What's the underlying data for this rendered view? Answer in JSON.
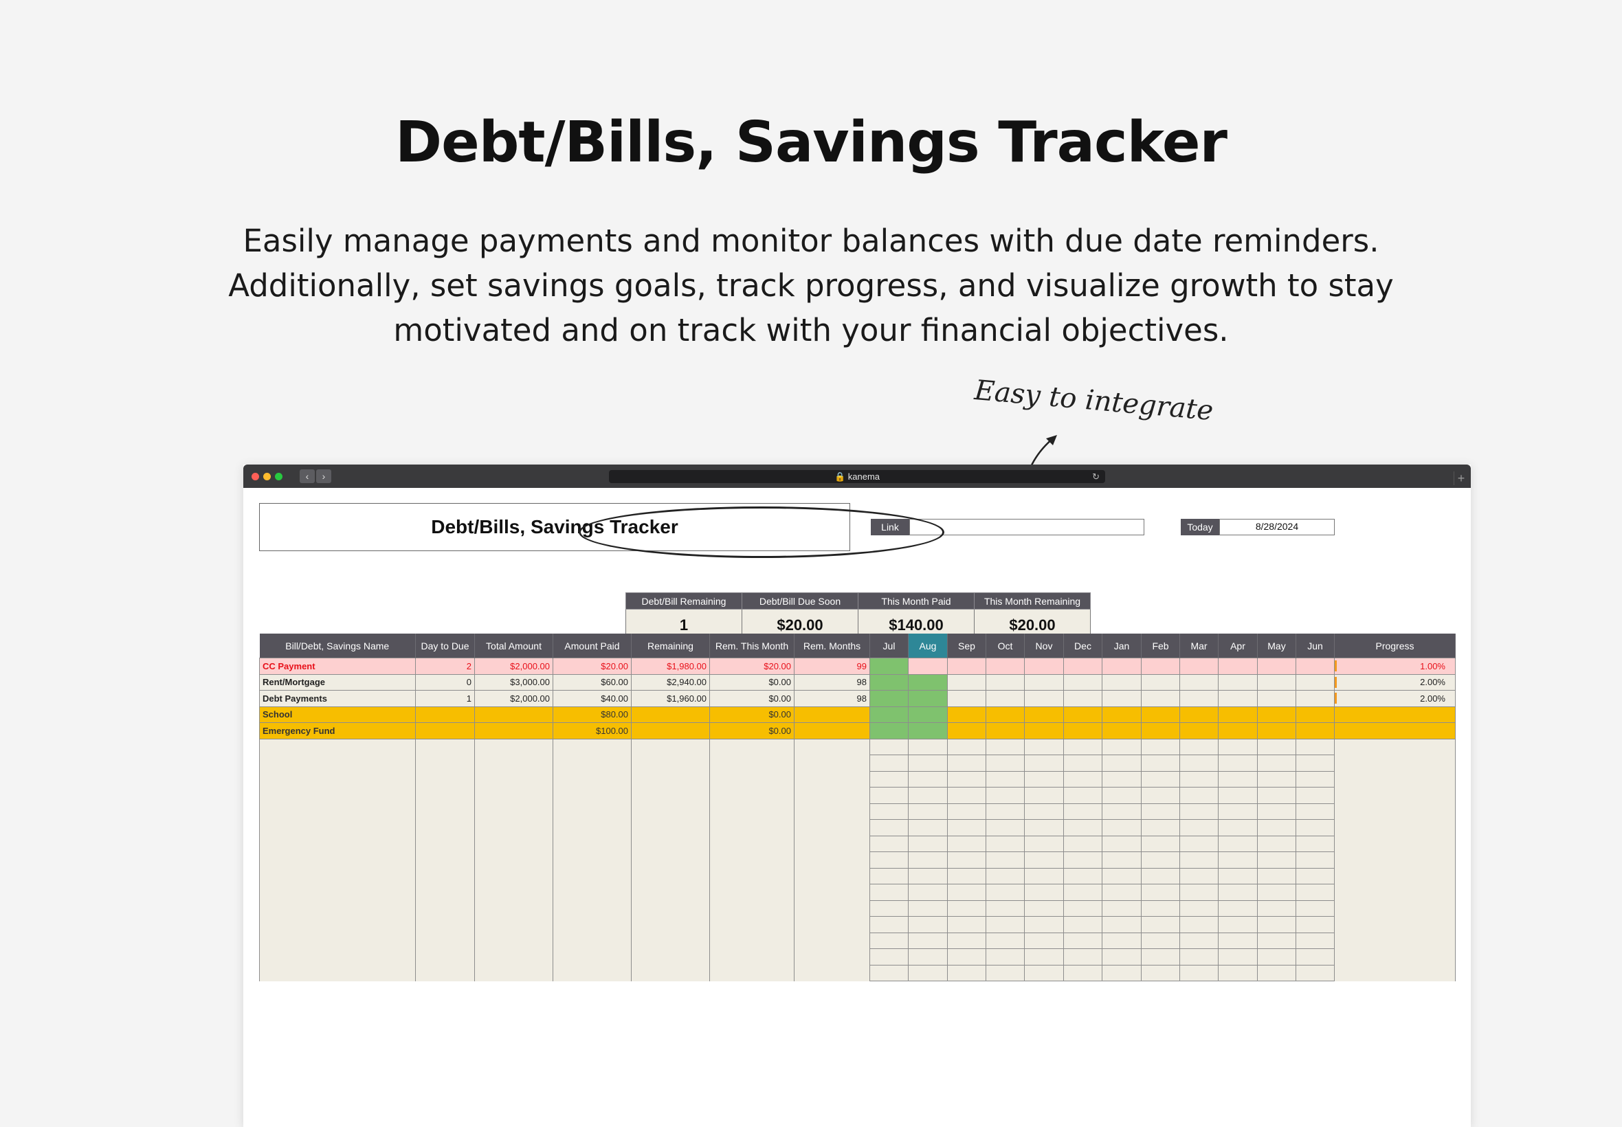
{
  "hero": {
    "title": "Debt/Bills, Savings Tracker",
    "description": "Easily manage payments and monitor balances with due date reminders. Additionally, set savings goals, track progress, and visualize growth to stay motivated and on track with your financial objectives."
  },
  "annotation": {
    "text": "Easy to integrate"
  },
  "browser": {
    "url": "kanema",
    "lock_icon": "lock-icon"
  },
  "sheet": {
    "title": "Debt/Bills, Savings Tracker",
    "link_label": "Link",
    "link_value": "",
    "today_label": "Today",
    "today_value": "8/28/2024",
    "summary": [
      {
        "label": "Debt/Bill Remaining",
        "value": "1"
      },
      {
        "label": "Debt/Bill Due Soon",
        "value": "$20.00"
      },
      {
        "label": "This Month Paid",
        "value": "$140.00"
      },
      {
        "label": "This Month Remaining",
        "value": "$20.00"
      }
    ],
    "columns": [
      "Bill/Debt, Savings Name",
      "Day to Due",
      "Total Amount",
      "Amount Paid",
      "Remaining",
      "Rem. This Month",
      "Rem. Months",
      "Jul",
      "Aug",
      "Sep",
      "Oct",
      "Nov",
      "Dec",
      "Jan",
      "Feb",
      "Mar",
      "Apr",
      "May",
      "Jun",
      "Progress"
    ],
    "current_month": "Aug",
    "rows": [
      {
        "name": "CC Payment",
        "day_to_due": "2",
        "total": "$2,000.00",
        "paid": "$20.00",
        "remaining": "$1,980.00",
        "rem_month": "$20.00",
        "rem_months": "99",
        "progress": "1.00%",
        "status": "due",
        "paid_months": [
          "Jul"
        ]
      },
      {
        "name": "Rent/Mortgage",
        "day_to_due": "0",
        "total": "$3,000.00",
        "paid": "$60.00",
        "remaining": "$2,940.00",
        "rem_month": "$0.00",
        "rem_months": "98",
        "progress": "2.00%",
        "status": "normal",
        "paid_months": [
          "Jul",
          "Aug"
        ]
      },
      {
        "name": "Debt Payments",
        "day_to_due": "1",
        "total": "$2,000.00",
        "paid": "$40.00",
        "remaining": "$1,960.00",
        "rem_month": "$0.00",
        "rem_months": "98",
        "progress": "2.00%",
        "status": "normal",
        "paid_months": [
          "Jul",
          "Aug"
        ]
      },
      {
        "name": "School",
        "day_to_due": "",
        "total": "",
        "paid": "$80.00",
        "remaining": "",
        "rem_month": "$0.00",
        "rem_months": "",
        "progress": "",
        "status": "savings",
        "paid_months": [
          "Jul",
          "Aug"
        ]
      },
      {
        "name": "Emergency Fund",
        "day_to_due": "",
        "total": "",
        "paid": "$100.00",
        "remaining": "",
        "rem_month": "$0.00",
        "rem_months": "",
        "progress": "",
        "status": "savings",
        "paid_months": [
          "Jul",
          "Aug"
        ]
      }
    ]
  },
  "colors": {
    "header": "#55535b",
    "current_month": "#2e8797",
    "due_row": "#fdd0d0",
    "due_text": "#e8101a",
    "savings_row": "#f7be00",
    "paid_cell": "#7fc26e",
    "progress_bar": "#f39a20",
    "sheet_bg": "#f0ede3"
  }
}
